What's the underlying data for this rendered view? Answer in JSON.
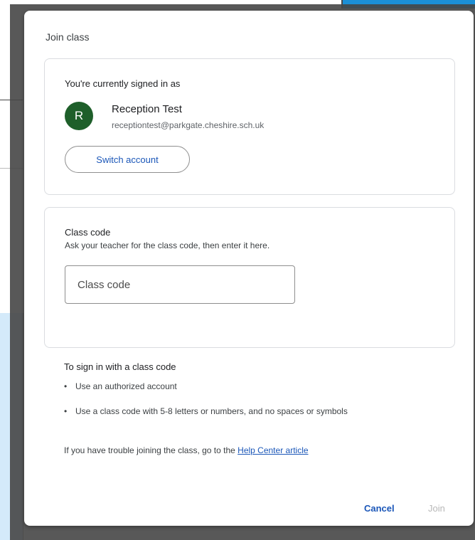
{
  "dialog": {
    "title": "Join class",
    "account": {
      "signed_in_label": "You're currently signed in as",
      "avatar_letter": "R",
      "avatar_color": "#1e5f2a",
      "name": "Reception Test",
      "email": "receptiontest@parkgate.cheshire.sch.uk",
      "switch_label": "Switch account"
    },
    "class_code": {
      "label": "Class code",
      "help": "Ask your teacher for the class code, then enter it here.",
      "value": "",
      "placeholder": "Class code"
    },
    "rules": {
      "title": "To sign in with a class code",
      "items": [
        "Use an authorized account",
        "Use a class code with 5-8 letters or numbers, and no spaces or symbols"
      ],
      "bullet": "•"
    },
    "trouble": {
      "text": "If you have trouble joining the class, go to the ",
      "link": "Help Center article"
    },
    "actions": {
      "cancel": "Cancel",
      "join": "Join"
    }
  },
  "colors": {
    "accent": "#1a56b8",
    "disabled": "#b7b7b7"
  }
}
